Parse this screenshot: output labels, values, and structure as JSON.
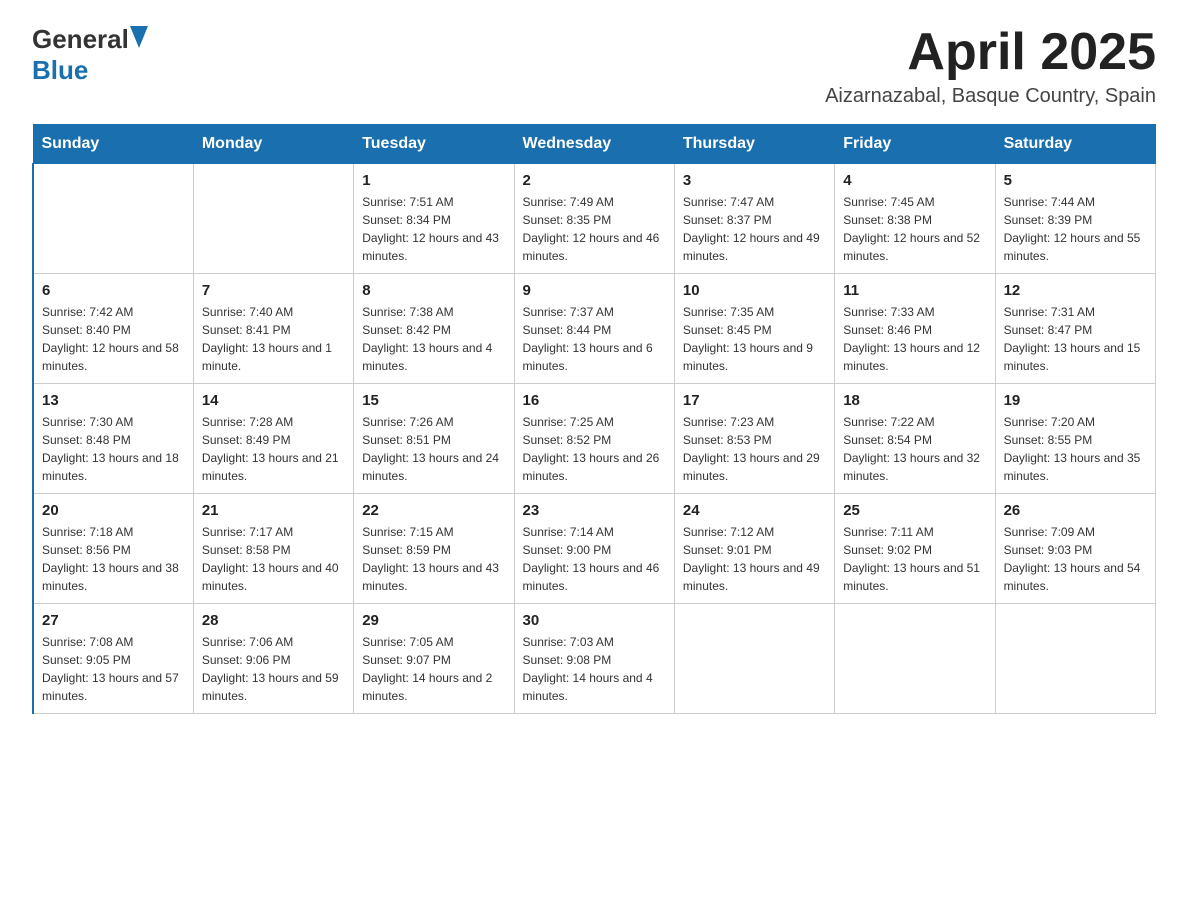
{
  "header": {
    "logo_general": "General",
    "logo_blue": "Blue",
    "month_title": "April 2025",
    "location": "Aizarnazabal, Basque Country, Spain"
  },
  "weekdays": [
    "Sunday",
    "Monday",
    "Tuesday",
    "Wednesday",
    "Thursday",
    "Friday",
    "Saturday"
  ],
  "weeks": [
    [
      {
        "day": "",
        "sunrise": "",
        "sunset": "",
        "daylight": ""
      },
      {
        "day": "",
        "sunrise": "",
        "sunset": "",
        "daylight": ""
      },
      {
        "day": "1",
        "sunrise": "Sunrise: 7:51 AM",
        "sunset": "Sunset: 8:34 PM",
        "daylight": "Daylight: 12 hours and 43 minutes."
      },
      {
        "day": "2",
        "sunrise": "Sunrise: 7:49 AM",
        "sunset": "Sunset: 8:35 PM",
        "daylight": "Daylight: 12 hours and 46 minutes."
      },
      {
        "day": "3",
        "sunrise": "Sunrise: 7:47 AM",
        "sunset": "Sunset: 8:37 PM",
        "daylight": "Daylight: 12 hours and 49 minutes."
      },
      {
        "day": "4",
        "sunrise": "Sunrise: 7:45 AM",
        "sunset": "Sunset: 8:38 PM",
        "daylight": "Daylight: 12 hours and 52 minutes."
      },
      {
        "day": "5",
        "sunrise": "Sunrise: 7:44 AM",
        "sunset": "Sunset: 8:39 PM",
        "daylight": "Daylight: 12 hours and 55 minutes."
      }
    ],
    [
      {
        "day": "6",
        "sunrise": "Sunrise: 7:42 AM",
        "sunset": "Sunset: 8:40 PM",
        "daylight": "Daylight: 12 hours and 58 minutes."
      },
      {
        "day": "7",
        "sunrise": "Sunrise: 7:40 AM",
        "sunset": "Sunset: 8:41 PM",
        "daylight": "Daylight: 13 hours and 1 minute."
      },
      {
        "day": "8",
        "sunrise": "Sunrise: 7:38 AM",
        "sunset": "Sunset: 8:42 PM",
        "daylight": "Daylight: 13 hours and 4 minutes."
      },
      {
        "day": "9",
        "sunrise": "Sunrise: 7:37 AM",
        "sunset": "Sunset: 8:44 PM",
        "daylight": "Daylight: 13 hours and 6 minutes."
      },
      {
        "day": "10",
        "sunrise": "Sunrise: 7:35 AM",
        "sunset": "Sunset: 8:45 PM",
        "daylight": "Daylight: 13 hours and 9 minutes."
      },
      {
        "day": "11",
        "sunrise": "Sunrise: 7:33 AM",
        "sunset": "Sunset: 8:46 PM",
        "daylight": "Daylight: 13 hours and 12 minutes."
      },
      {
        "day": "12",
        "sunrise": "Sunrise: 7:31 AM",
        "sunset": "Sunset: 8:47 PM",
        "daylight": "Daylight: 13 hours and 15 minutes."
      }
    ],
    [
      {
        "day": "13",
        "sunrise": "Sunrise: 7:30 AM",
        "sunset": "Sunset: 8:48 PM",
        "daylight": "Daylight: 13 hours and 18 minutes."
      },
      {
        "day": "14",
        "sunrise": "Sunrise: 7:28 AM",
        "sunset": "Sunset: 8:49 PM",
        "daylight": "Daylight: 13 hours and 21 minutes."
      },
      {
        "day": "15",
        "sunrise": "Sunrise: 7:26 AM",
        "sunset": "Sunset: 8:51 PM",
        "daylight": "Daylight: 13 hours and 24 minutes."
      },
      {
        "day": "16",
        "sunrise": "Sunrise: 7:25 AM",
        "sunset": "Sunset: 8:52 PM",
        "daylight": "Daylight: 13 hours and 26 minutes."
      },
      {
        "day": "17",
        "sunrise": "Sunrise: 7:23 AM",
        "sunset": "Sunset: 8:53 PM",
        "daylight": "Daylight: 13 hours and 29 minutes."
      },
      {
        "day": "18",
        "sunrise": "Sunrise: 7:22 AM",
        "sunset": "Sunset: 8:54 PM",
        "daylight": "Daylight: 13 hours and 32 minutes."
      },
      {
        "day": "19",
        "sunrise": "Sunrise: 7:20 AM",
        "sunset": "Sunset: 8:55 PM",
        "daylight": "Daylight: 13 hours and 35 minutes."
      }
    ],
    [
      {
        "day": "20",
        "sunrise": "Sunrise: 7:18 AM",
        "sunset": "Sunset: 8:56 PM",
        "daylight": "Daylight: 13 hours and 38 minutes."
      },
      {
        "day": "21",
        "sunrise": "Sunrise: 7:17 AM",
        "sunset": "Sunset: 8:58 PM",
        "daylight": "Daylight: 13 hours and 40 minutes."
      },
      {
        "day": "22",
        "sunrise": "Sunrise: 7:15 AM",
        "sunset": "Sunset: 8:59 PM",
        "daylight": "Daylight: 13 hours and 43 minutes."
      },
      {
        "day": "23",
        "sunrise": "Sunrise: 7:14 AM",
        "sunset": "Sunset: 9:00 PM",
        "daylight": "Daylight: 13 hours and 46 minutes."
      },
      {
        "day": "24",
        "sunrise": "Sunrise: 7:12 AM",
        "sunset": "Sunset: 9:01 PM",
        "daylight": "Daylight: 13 hours and 49 minutes."
      },
      {
        "day": "25",
        "sunrise": "Sunrise: 7:11 AM",
        "sunset": "Sunset: 9:02 PM",
        "daylight": "Daylight: 13 hours and 51 minutes."
      },
      {
        "day": "26",
        "sunrise": "Sunrise: 7:09 AM",
        "sunset": "Sunset: 9:03 PM",
        "daylight": "Daylight: 13 hours and 54 minutes."
      }
    ],
    [
      {
        "day": "27",
        "sunrise": "Sunrise: 7:08 AM",
        "sunset": "Sunset: 9:05 PM",
        "daylight": "Daylight: 13 hours and 57 minutes."
      },
      {
        "day": "28",
        "sunrise": "Sunrise: 7:06 AM",
        "sunset": "Sunset: 9:06 PM",
        "daylight": "Daylight: 13 hours and 59 minutes."
      },
      {
        "day": "29",
        "sunrise": "Sunrise: 7:05 AM",
        "sunset": "Sunset: 9:07 PM",
        "daylight": "Daylight: 14 hours and 2 minutes."
      },
      {
        "day": "30",
        "sunrise": "Sunrise: 7:03 AM",
        "sunset": "Sunset: 9:08 PM",
        "daylight": "Daylight: 14 hours and 4 minutes."
      },
      {
        "day": "",
        "sunrise": "",
        "sunset": "",
        "daylight": ""
      },
      {
        "day": "",
        "sunrise": "",
        "sunset": "",
        "daylight": ""
      },
      {
        "day": "",
        "sunrise": "",
        "sunset": "",
        "daylight": ""
      }
    ]
  ]
}
